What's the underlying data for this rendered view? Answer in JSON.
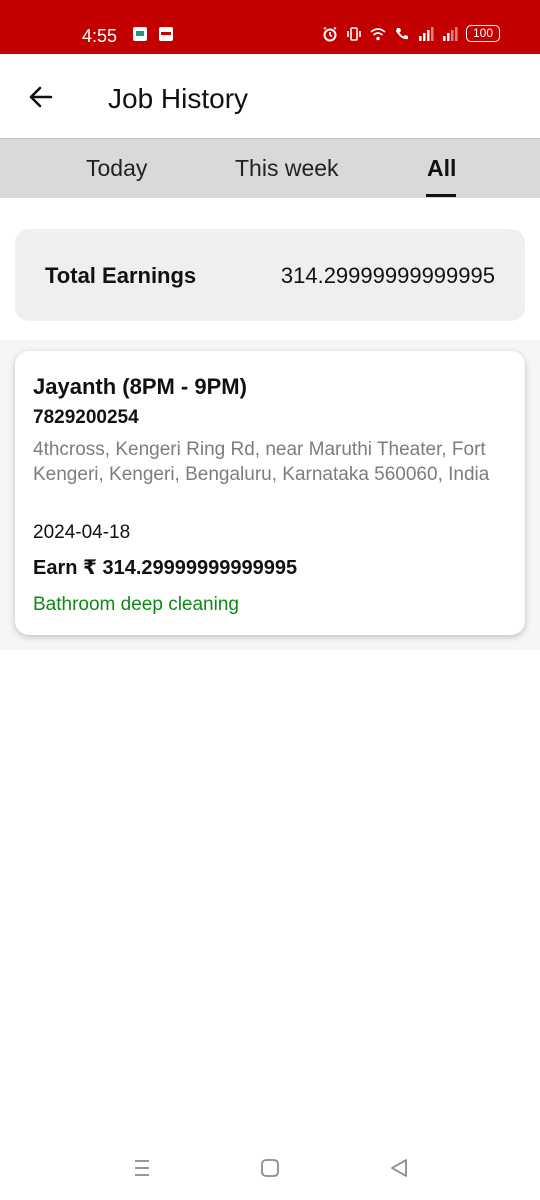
{
  "status_bar": {
    "time": "4:55",
    "battery": "100",
    "color": "#c20000"
  },
  "app_bar": {
    "title": "Job History",
    "back_icon": "arrow-left-icon"
  },
  "tabs": [
    {
      "label": "Today",
      "selected": false
    },
    {
      "label": "This week",
      "selected": false
    },
    {
      "label": "All",
      "selected": true
    }
  ],
  "summary": {
    "label": "Total Earnings",
    "value": "314.29999999999995"
  },
  "jobs": [
    {
      "title": "Jayanth (8PM - 9PM)",
      "phone": "7829200254",
      "address": "4thcross, Kengeri Ring Rd, near Maruthi Theater, Fort Kengeri, Kengeri, Bengaluru, Karnataka 560060, India",
      "date": "2024-04-18",
      "earn": "Earn ₹ 314.29999999999995",
      "service": "Bathroom deep cleaning",
      "service_color": "#0d8a13"
    }
  ],
  "nav_bar": {
    "icons": [
      "menu-icon",
      "home-icon",
      "back-icon"
    ]
  }
}
